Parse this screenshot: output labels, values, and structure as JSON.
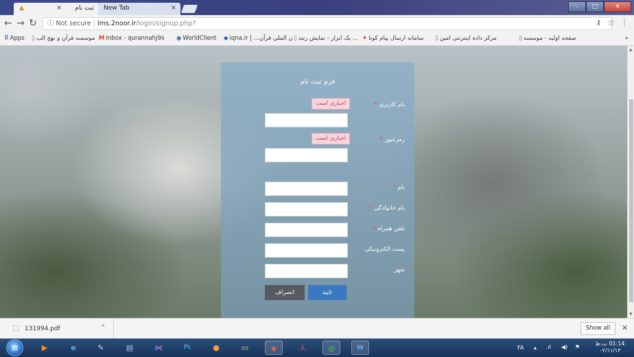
{
  "browser": {
    "tabs": [
      {
        "title": "ثبت نام",
        "active": true,
        "close_glyph": "×",
        "favicon": "site-logo-icon"
      },
      {
        "title": "New Tab",
        "active": false,
        "close_glyph": "×"
      }
    ],
    "window_controls": {
      "minimize": "–",
      "maximize": "□",
      "close": "✕"
    },
    "address": {
      "security_label": "Not secure",
      "separator": "|",
      "host": "lms.2noor.ir",
      "path": "/login/signup.php?"
    },
    "bookmarks": [
      {
        "label": "Apps",
        "icon": "apps-grid-icon"
      },
      {
        "label": "موسسه قرآن و نهج الب",
        "icon": "page-icon"
      },
      {
        "label": "Inbox - qurannahj9٥",
        "icon": "gmail-icon"
      },
      {
        "label": "WorldClient",
        "icon": "globe-icon"
      },
      {
        "label": "iqna.ir | ...ن الملی قرآن",
        "icon": "diamond-icon"
      },
      {
        "label": "یک ابزار - نمایش رتبه ...",
        "icon": "page-icon"
      },
      {
        "label": "سامانه ارسال پیام کوتا",
        "icon": "red-icon"
      },
      {
        "label": "مرکز داده اینترنتی امین",
        "icon": "page-icon"
      },
      {
        "label": "صفحه اولیه - موسسه",
        "icon": "page-icon"
      }
    ]
  },
  "form": {
    "title": "فرم ثبت نام",
    "required_badge": "اجباری است",
    "required_marker": "*",
    "fields": {
      "username": {
        "label": "نام کاربری",
        "value": ""
      },
      "password": {
        "label": "رمزعبور",
        "value": ""
      },
      "firstname": {
        "label": "نام",
        "value": ""
      },
      "lastname": {
        "label": "نام خانوادگی",
        "value": ""
      },
      "mobile": {
        "label": "تلفن همراه",
        "value": ""
      },
      "email": {
        "label": "پست الکترونیکی",
        "value": ""
      },
      "city": {
        "label": "شهر",
        "value": ""
      }
    },
    "confirm_button": "تایید",
    "cancel_button": "انصراف"
  },
  "downloads": {
    "file_name": "131994.pdf",
    "show_all": "Show all"
  },
  "taskbar": {
    "language": "FA",
    "time": "01:14 ب.ظ",
    "date": "۰۲/۱۱/۱۳"
  },
  "colors": {
    "accent": "#3a78c2",
    "cancel": "#555b60",
    "required": "#d23f55"
  }
}
